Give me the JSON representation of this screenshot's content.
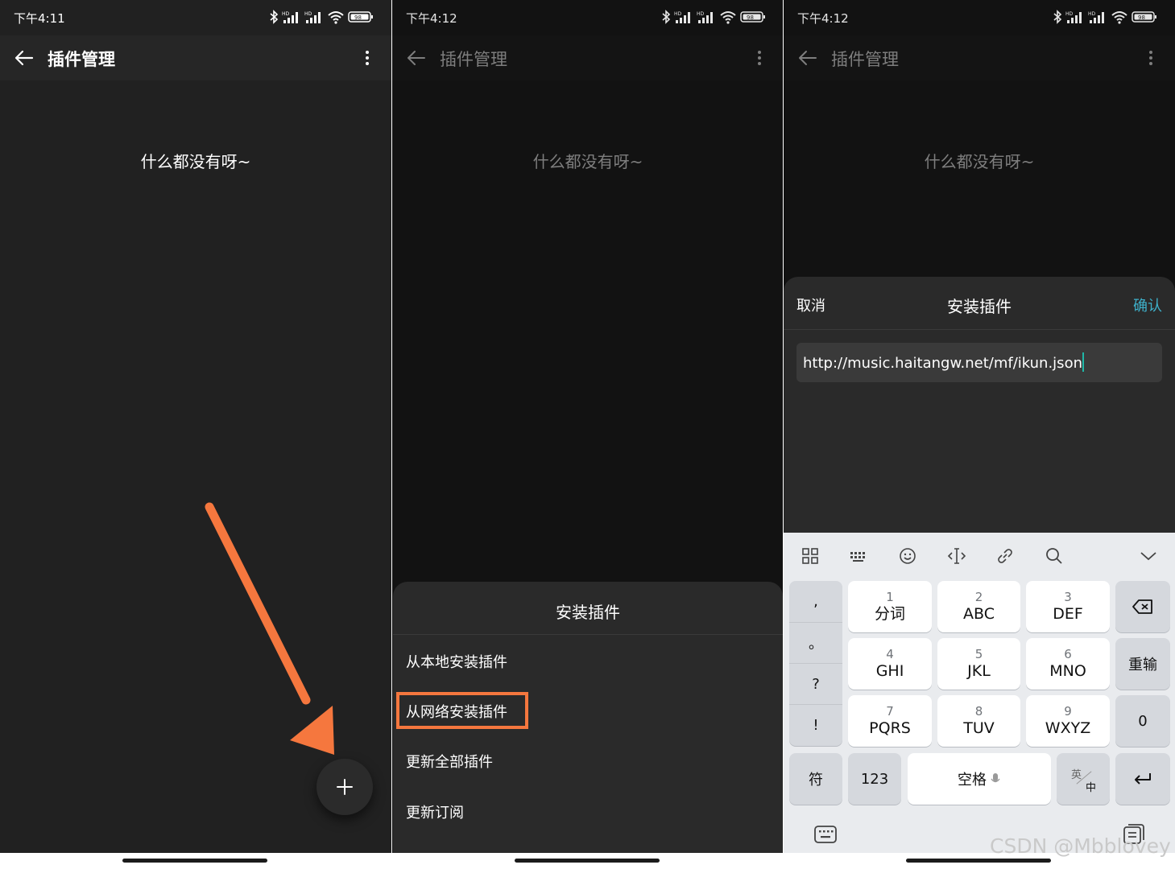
{
  "statusbar": {
    "time1": "下午4:11",
    "time2": "下午4:12",
    "time3": "下午4:12",
    "battery": "98",
    "network_label": "HD"
  },
  "appbar": {
    "title": "插件管理"
  },
  "empty_text": "什么都没有呀~",
  "icons": {
    "back": "arrow-left-icon",
    "more": "more-vertical-icon",
    "add": "plus-icon",
    "annotation": "orange-arrow-icon"
  },
  "colors": {
    "highlight": "#f5773e",
    "confirm": "#3eb1cb",
    "caret": "#1fb7a7",
    "background": "#212121"
  },
  "sheet": {
    "title": "安装插件",
    "items": [
      "从本地安装插件",
      "从网络安装插件",
      "更新全部插件",
      "更新订阅"
    ]
  },
  "dialog": {
    "cancel": "取消",
    "title": "安装插件",
    "confirm": "确认",
    "url": "http://music.haitangw.net/mf/ikun.json"
  },
  "keyboard": {
    "punct": [
      ",",
      "。",
      "?",
      "!"
    ],
    "keys": [
      {
        "num": "1",
        "letters": "分词"
      },
      {
        "num": "2",
        "letters": "ABC"
      },
      {
        "num": "3",
        "letters": "DEF"
      },
      {
        "num": "4",
        "letters": "GHI"
      },
      {
        "num": "5",
        "letters": "JKL"
      },
      {
        "num": "6",
        "letters": "MNO"
      },
      {
        "num": "7",
        "letters": "PQRS"
      },
      {
        "num": "8",
        "letters": "TUV"
      },
      {
        "num": "9",
        "letters": "WXYZ"
      }
    ],
    "reenter": "重输",
    "zero": "0",
    "symbol": "符",
    "num123": "123",
    "space": "空格",
    "lang_en": "英",
    "lang_zh": "中"
  },
  "watermark": "CSDN @Mbblovey"
}
